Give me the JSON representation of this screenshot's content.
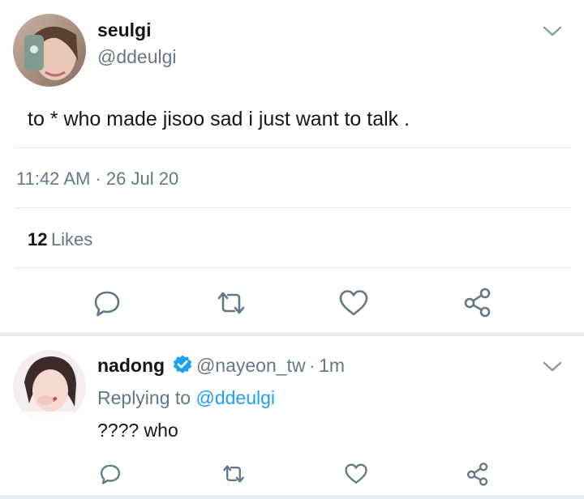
{
  "tweet": {
    "name": "seulgi",
    "handle": "@ddeulgi",
    "text": "to * who made jisoo sad i just want to talk .",
    "time": "11:42 AM",
    "separator": "·",
    "date": "26 Jul 20",
    "likes_count": "12",
    "likes_label": "Likes"
  },
  "reply": {
    "name": "nadong",
    "handle": "@nayeon_tw",
    "separator": "·",
    "time": "1m",
    "replying_prefix": "Replying to",
    "replying_to": "@ddeulgi",
    "text": "???? who"
  },
  "colors": {
    "text": "#14171a",
    "muted": "#657786",
    "link": "#1da1f2",
    "verified": "#1da1f2",
    "divider": "#e1e8ed"
  }
}
